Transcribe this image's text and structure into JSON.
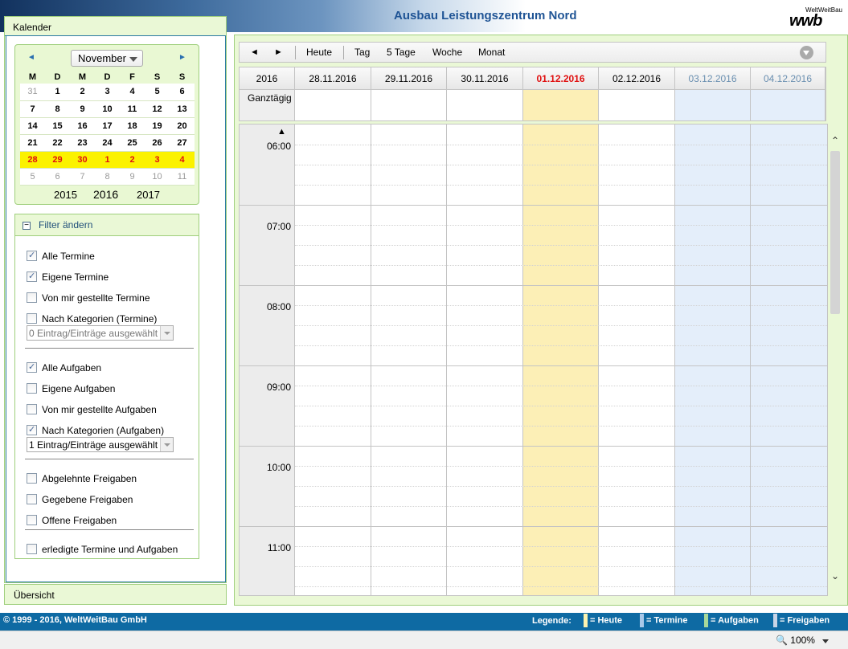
{
  "header": {
    "title": "Ausbau Leistungszentrum Nord",
    "logo_small": "WeltWeitBau",
    "logo_big": "wwb"
  },
  "left": {
    "tab_label": "Kalender",
    "minical": {
      "month": "November",
      "weekdays": [
        "M",
        "D",
        "M",
        "D",
        "F",
        "S",
        "S"
      ],
      "weeks": [
        [
          "31",
          "1",
          "2",
          "3",
          "4",
          "5",
          "6"
        ],
        [
          "7",
          "8",
          "9",
          "10",
          "11",
          "12",
          "13"
        ],
        [
          "14",
          "15",
          "16",
          "17",
          "18",
          "19",
          "20"
        ],
        [
          "21",
          "22",
          "23",
          "24",
          "25",
          "26",
          "27"
        ],
        [
          "28",
          "29",
          "30",
          "1",
          "2",
          "3",
          "4"
        ],
        [
          "5",
          "6",
          "7",
          "8",
          "9",
          "10",
          "11"
        ]
      ],
      "years": [
        "2015",
        "2016",
        "2017"
      ]
    },
    "filter": {
      "title": "Filter ändern",
      "toggle": "−",
      "items": [
        {
          "label": "Alle Termine",
          "checked": true
        },
        {
          "label": "Eigene Termine",
          "checked": true
        },
        {
          "label": "Von mir gestellte Termine",
          "checked": false
        },
        {
          "label": "Nach Kategorien (Termine)",
          "checked": false
        },
        {
          "label": "Alle Aufgaben",
          "checked": true
        },
        {
          "label": "Eigene Aufgaben",
          "checked": false
        },
        {
          "label": "Von mir gestellte Aufgaben",
          "checked": false
        },
        {
          "label": "Nach Kategorien (Aufgaben)",
          "checked": true
        },
        {
          "label": "Abgelehnte Freigaben",
          "checked": false
        },
        {
          "label": "Gegebene Freigaben",
          "checked": false
        },
        {
          "label": "Offene Freigaben",
          "checked": false
        },
        {
          "label": "erledigte Termine und Aufgaben",
          "checked": false
        }
      ],
      "select_termine": "0 Eintrag/Einträge ausgewählt",
      "select_aufgaben": "1 Eintrag/Einträge ausgewählt"
    },
    "overview_label": "Übersicht"
  },
  "toolbar": {
    "prev": "◄",
    "next": "►",
    "today": "Heute",
    "day": "Tag",
    "five_days": "5 Tage",
    "week": "Woche",
    "month": "Monat"
  },
  "calendar": {
    "year": "2016",
    "allday_label": "Ganztägig",
    "days": [
      {
        "date": "28.11.2016",
        "type": "normal"
      },
      {
        "date": "29.11.2016",
        "type": "normal"
      },
      {
        "date": "30.11.2016",
        "type": "normal"
      },
      {
        "date": "01.12.2016",
        "type": "today"
      },
      {
        "date": "02.12.2016",
        "type": "normal"
      },
      {
        "date": "03.12.2016",
        "type": "weekend"
      },
      {
        "date": "04.12.2016",
        "type": "weekend"
      }
    ],
    "hours": [
      "06:00",
      "07:00",
      "08:00",
      "09:00",
      "10:00",
      "11:00"
    ]
  },
  "footer": {
    "copyright": "© 1999 - 2016, WeltWeitBau GmbH",
    "legend_label": "Legende:",
    "legend": [
      {
        "label": "= Heute",
        "color": "#fdf3b0"
      },
      {
        "label": "= Termine",
        "color": "#a9c8e8"
      },
      {
        "label": "= Aufgaben",
        "color": "#a8d89a"
      },
      {
        "label": "= Freigaben",
        "color": "#c9d4e6"
      }
    ]
  },
  "statusbar": {
    "zoom": "100%"
  }
}
